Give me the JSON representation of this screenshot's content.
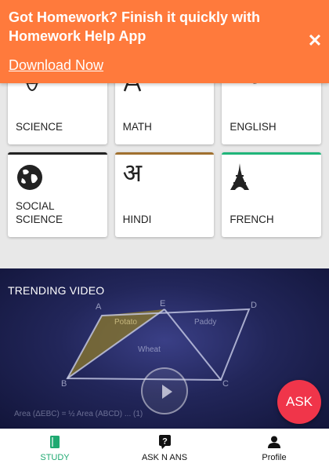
{
  "banner": {
    "headline": "Got Homework? Finish it quickly with Homework Help App",
    "download_label": "Download Now",
    "close_icon": "close-icon",
    "color": "#ff7a3c"
  },
  "subjects": [
    {
      "label": "SCIENCE",
      "icon": "atom-icon"
    },
    {
      "label": "MATH",
      "icon": "math-a-icon"
    },
    {
      "label": "ENGLISH",
      "icon": "aa-letters-icon"
    },
    {
      "label": "SOCIAL SCIENCE",
      "icon": "globe-icon",
      "accent": "#222222"
    },
    {
      "label": "HINDI",
      "icon": "hindi-letter-icon",
      "glyph": "अ",
      "accent": "#a0702f"
    },
    {
      "label": "FRENCH",
      "icon": "eiffel-tower-icon",
      "accent": "#1fb57a"
    }
  ],
  "trending": {
    "title": "TRENDING VIDEO",
    "thumbnail_text": {
      "points": [
        "A",
        "E",
        "D",
        "B",
        "C"
      ],
      "regions": [
        "Potato",
        "Paddy",
        "Wheat"
      ],
      "formula": "Area (ΔEBC) = ½ Area (ABCD) ... (1)"
    }
  },
  "fab": {
    "label": "ASK",
    "color": "#f0354a"
  },
  "nav": [
    {
      "label": "STUDY",
      "icon": "book-icon",
      "active": true
    },
    {
      "label": "ASK N ANS",
      "icon": "question-icon",
      "active": false
    },
    {
      "label": "Profile",
      "icon": "person-icon",
      "active": false
    }
  ]
}
